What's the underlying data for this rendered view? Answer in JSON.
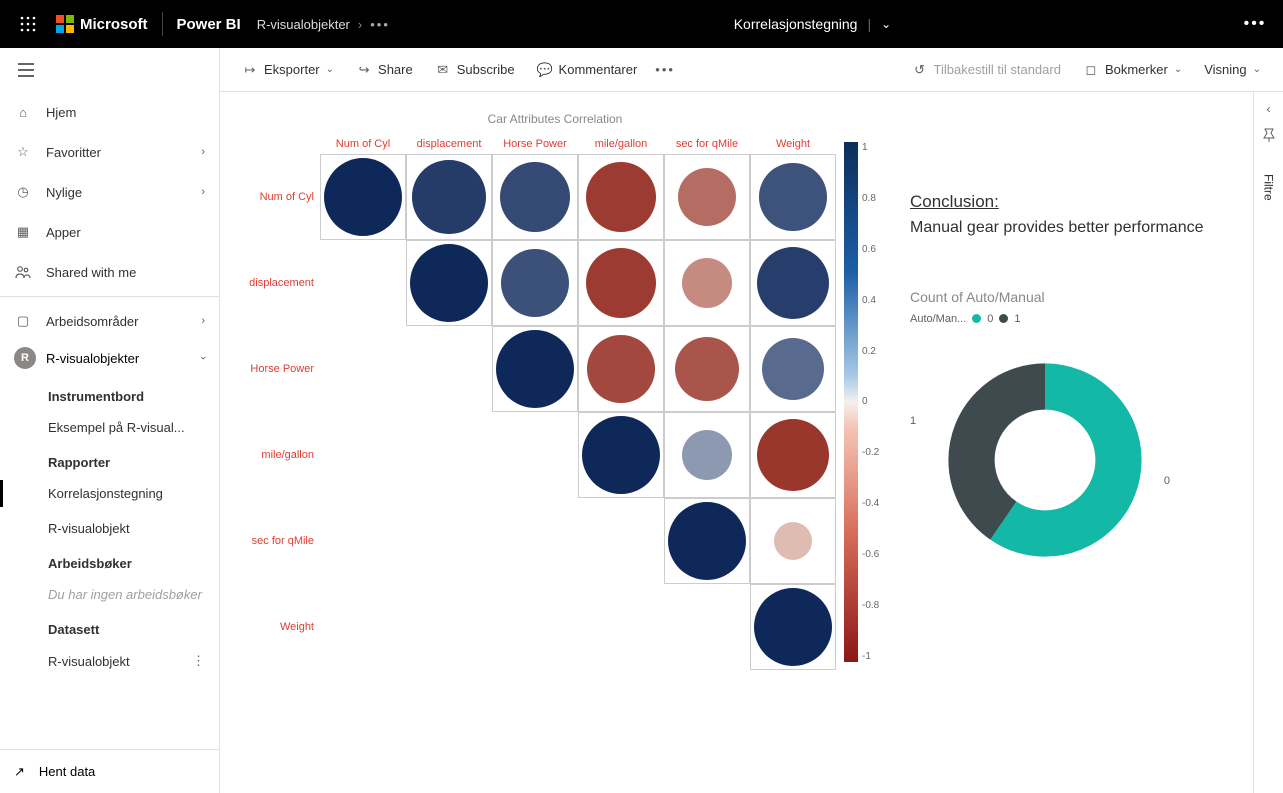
{
  "topbar": {
    "brand": "Microsoft",
    "product": "Power BI",
    "breadcrumb_workspace": "R-visualobjekter",
    "report_title": "Korrelasjonstegning"
  },
  "nav": {
    "home": "Hjem",
    "favorites": "Favoritter",
    "recent": "Nylige",
    "apps": "Apper",
    "shared": "Shared with me",
    "workspaces": "Arbeidsområder",
    "current_ws": "R-visualobjekter",
    "sec_dashboards": "Instrumentbord",
    "item_example": "Eksempel på R-visual...",
    "sec_reports": "Rapporter",
    "item_corr": "Korrelasjonstegning",
    "item_rvis": "R-visualobjekt",
    "sec_workbooks": "Arbeidsbøker",
    "item_noworkbooks": "Du har ingen arbeidsbøker",
    "sec_datasets": "Datasett",
    "item_rvis2": "R-visualobjekt",
    "getdata": "Hent data"
  },
  "toolbar": {
    "export": "Eksporter",
    "share": "Share",
    "subscribe": "Subscribe",
    "comments": "Kommentarer",
    "reset": "Tilbakestill til standard",
    "bookmarks": "Bokmerker",
    "view": "Visning"
  },
  "conclusion": {
    "heading": "Conclusion:",
    "text": "Manual gear provides better performance"
  },
  "donut": {
    "title": "Count of Auto/Manual",
    "legend_name": "Auto/Man...",
    "cat0": "0",
    "cat1": "1",
    "label0": "0",
    "label1": "1",
    "color0": "#14b8a6",
    "color1": "#3f4a4f"
  },
  "filters_label": "Filtre",
  "chart_data": {
    "type": "heatmap",
    "title": "Car Attributes Correlation",
    "variables": [
      "Num of Cyl",
      "displacement",
      "Horse Power",
      "mile/gallon",
      "sec for qMile",
      "Weight"
    ],
    "scale_ticks": [
      "1",
      "0.8",
      "0.6",
      "0.4",
      "0.2",
      "0",
      "-0.2",
      "-0.4",
      "-0.6",
      "-0.8",
      "-1"
    ],
    "matrix": [
      [
        1.0,
        0.9,
        0.83,
        -0.85,
        -0.59,
        0.78
      ],
      [
        null,
        1.0,
        0.79,
        -0.85,
        -0.43,
        0.89
      ],
      [
        null,
        null,
        1.0,
        -0.78,
        -0.71,
        0.66
      ],
      [
        null,
        null,
        null,
        1.0,
        0.42,
        -0.87
      ],
      [
        null,
        null,
        null,
        null,
        1.0,
        -0.17
      ],
      [
        null,
        null,
        null,
        null,
        null,
        1.0
      ]
    ],
    "donut": {
      "series": [
        {
          "name": "0",
          "value": 19
        },
        {
          "name": "1",
          "value": 13
        }
      ]
    }
  }
}
